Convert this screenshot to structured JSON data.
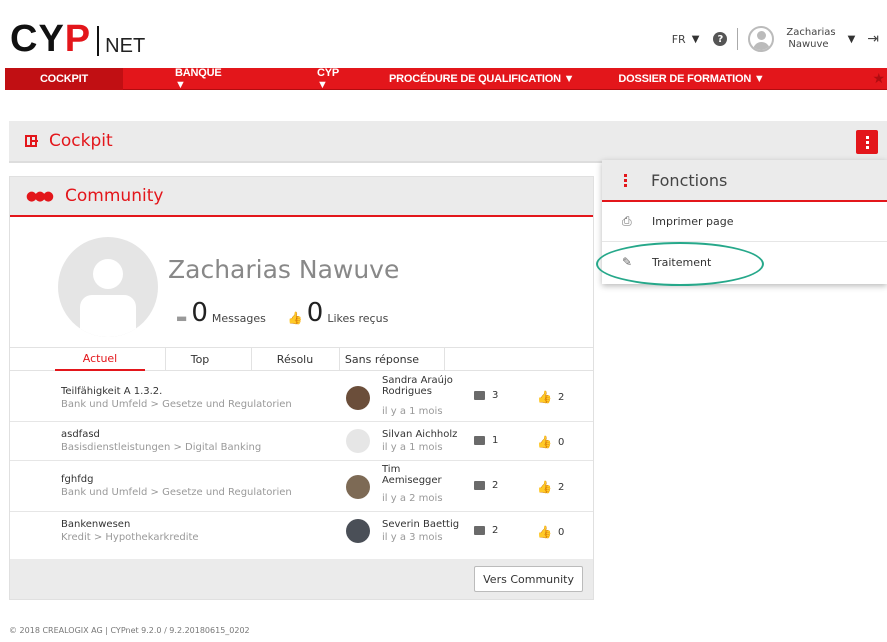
{
  "brand": {
    "logo_text": "CYP",
    "logo_sub": "NET"
  },
  "header": {
    "language": "FR",
    "user_first": "Zacharias",
    "user_last": "Nawuve"
  },
  "nav": {
    "items": [
      {
        "label": "COCKPIT"
      },
      {
        "label": "BANQUE ▼"
      },
      {
        "label": "CYP ▼"
      },
      {
        "label": "PROCÉDURE DE QUALIFICATION ▼"
      },
      {
        "label": "DOSSIER DE FORMATION ▼"
      }
    ]
  },
  "cockpit": {
    "title": "Cockpit"
  },
  "community": {
    "title": "Community",
    "profile_name": "Zacharias Nawuve",
    "messages_count": "0",
    "messages_label": "Messages",
    "likes_count": "0",
    "likes_label": "Likes reçus",
    "tabs": [
      "Actuel",
      "Top",
      "Résolu",
      "Sans réponse"
    ],
    "active_tab": "Actuel",
    "rows": [
      {
        "title": "Teilfähigkeit A 1.3.2.",
        "path": "Bank und Umfeld > Gesetze und Regulatorien",
        "user": "Sandra Araújo Rodrigues",
        "time": "il y a 1 mois",
        "messages": "3",
        "likes": "2"
      },
      {
        "title": "asdfasd",
        "path": "Basisdienstleistungen > Digital Banking",
        "user": "Silvan Aichholz",
        "time": "il y a 1 mois",
        "messages": "1",
        "likes": "0"
      },
      {
        "title": "fghfdg",
        "path": "Bank und Umfeld > Gesetze und Regulatorien",
        "user": "Tim Aemisegger",
        "time": "il y a 2 mois",
        "messages": "2",
        "likes": "2"
      },
      {
        "title": "Bankenwesen",
        "path": "Kredit > Hypothekarkredite",
        "user": "Severin Baettig",
        "time": "il y a 3 mois",
        "messages": "2",
        "likes": "0"
      }
    ],
    "footer_button": "Vers Community"
  },
  "functions_menu": {
    "title": "Fonctions",
    "items": [
      {
        "label": "Imprimer page",
        "icon": "printer-icon"
      },
      {
        "label": "Traitement",
        "icon": "edit-icon"
      }
    ]
  },
  "footer": {
    "text": "© 2018 CREALOGIX AG  |  CYPnet 9.2.0 / 9.2.20180615_0202"
  },
  "colors": {
    "accent": "#e3161b",
    "highlight": "#26a88a",
    "panel": "#ebebeb"
  }
}
